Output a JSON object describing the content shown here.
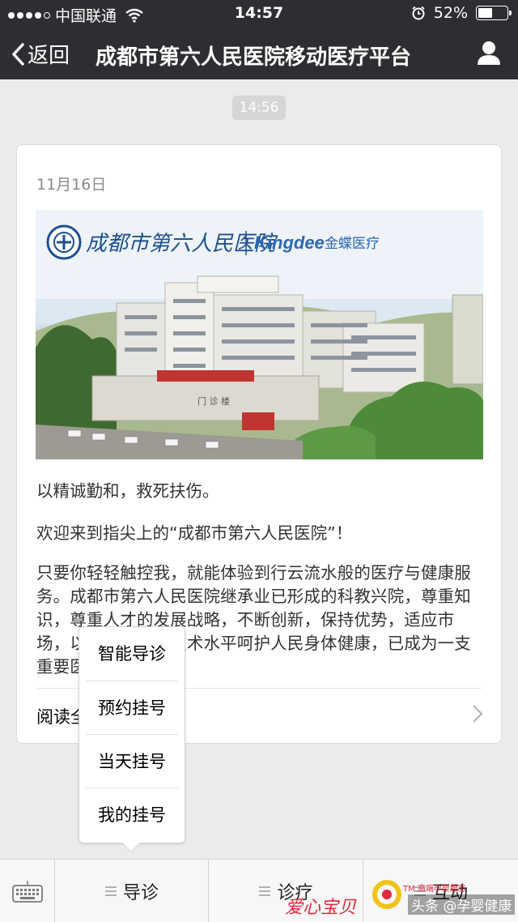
{
  "status_bar": {
    "carrier": "中国联通",
    "time": "14:57",
    "battery_percent": "52%",
    "battery_level": 0.52
  },
  "nav": {
    "back_label": "返回",
    "title": "成都市第六人民医院移动医疗平台"
  },
  "chat": {
    "timestamp": "14:56"
  },
  "article": {
    "date": "11月16日",
    "banner": {
      "hospital_name": "成都市第六人民医院",
      "partner_brand": "Kingdee",
      "partner_cn": "金蝶医疗",
      "gate_sign": "门 诊 楼"
    },
    "motto": "以精诚勤和，救死扶伤。",
    "welcome": "欢迎来到指尖上的“成都市第六人民医院”！",
    "body": "只要你轻轻触控我，就能体验到行云流水般的医疗与健康服务。成都市第六人民医院继承业已形成的科教兴院，尊重知识，尊重人才的发展战略，不断创新，保持优势，适应市场，以一流的医疗技术水平呵护人民身体健康，已成为一支重要医疗队伍。",
    "read_all": "阅读全文"
  },
  "popup_menu": {
    "items": [
      "智能导诊",
      "预约挂号",
      "当天挂号",
      "我的挂号"
    ]
  },
  "tab_bar": {
    "tabs": [
      "导诊",
      "诊疗",
      "互动"
    ]
  },
  "watermark": {
    "left": "爱心宝贝",
    "right": "头条 @孕婴健康",
    "small": "TM 高端孕婴服务"
  },
  "colors": {
    "nav_bg": "#2e2e32",
    "watermark_red": "#e0283c"
  }
}
